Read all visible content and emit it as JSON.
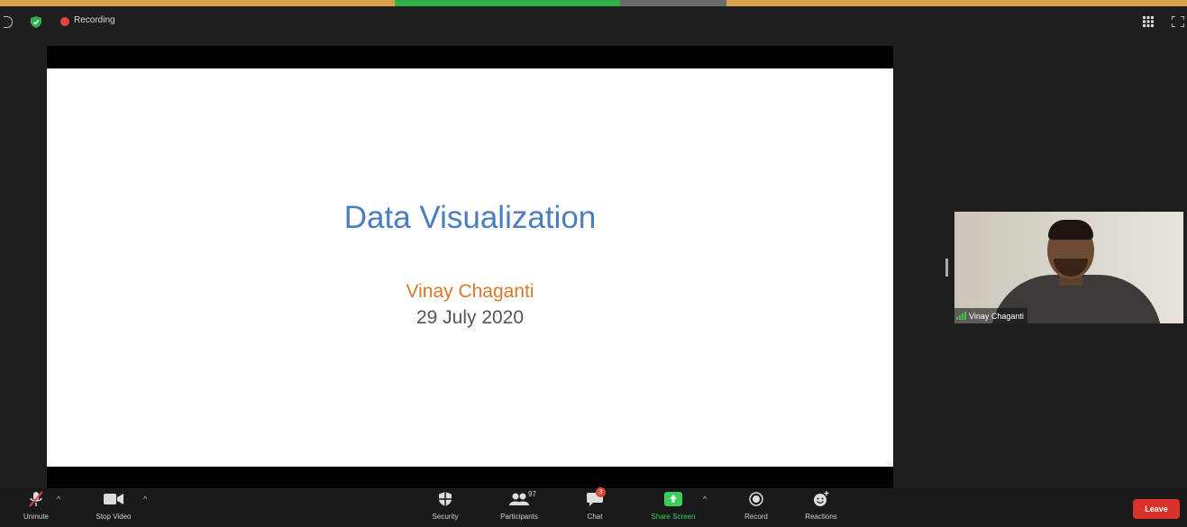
{
  "status_bar": {
    "recording_label": "Recording"
  },
  "slide": {
    "title": "Data Visualization",
    "author": "Vinay Chaganti",
    "date": "29 July 2020"
  },
  "participant": {
    "name": "Vinay Chaganti"
  },
  "toolbar": {
    "unmute_label": "Unmute",
    "stop_video_label": "Stop Video",
    "security_label": "Security",
    "participants_label": "Participants",
    "participants_count": "97",
    "chat_label": "Chat",
    "chat_badge": "3",
    "share_screen_label": "Share Screen",
    "record_label": "Record",
    "reactions_label": "Reactions",
    "leave_label": "Leave"
  },
  "colors": {
    "accent_green": "#3ccf5a",
    "recording_red": "#e0473b",
    "leave_red": "#d9322b",
    "slide_title_blue": "#4a7ec0",
    "slide_author_orange": "#d9772b"
  }
}
